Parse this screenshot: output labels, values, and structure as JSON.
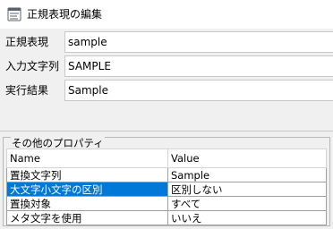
{
  "window": {
    "title": "正規表現の編集",
    "icon": "app-icon"
  },
  "form": {
    "regex_label": "正規表現",
    "regex_value": "sample",
    "input_label": "入力文字列",
    "input_value": "SAMPLE",
    "result_label": "実行結果",
    "result_value": "Sample"
  },
  "properties": {
    "group_title": "その他のプロパティ",
    "columns": [
      "Name",
      "Value"
    ],
    "rows": [
      {
        "name": "置換文字列",
        "value": "Sample"
      },
      {
        "name": "大文字小文字の区別",
        "value": "区別しない",
        "selected": true
      },
      {
        "name": "置換対象",
        "value": "すべて"
      },
      {
        "name": "メタ文字を使用",
        "value": "いいえ"
      }
    ]
  },
  "colors": {
    "selection": "#0078d7",
    "background": "#f0f0f0"
  }
}
